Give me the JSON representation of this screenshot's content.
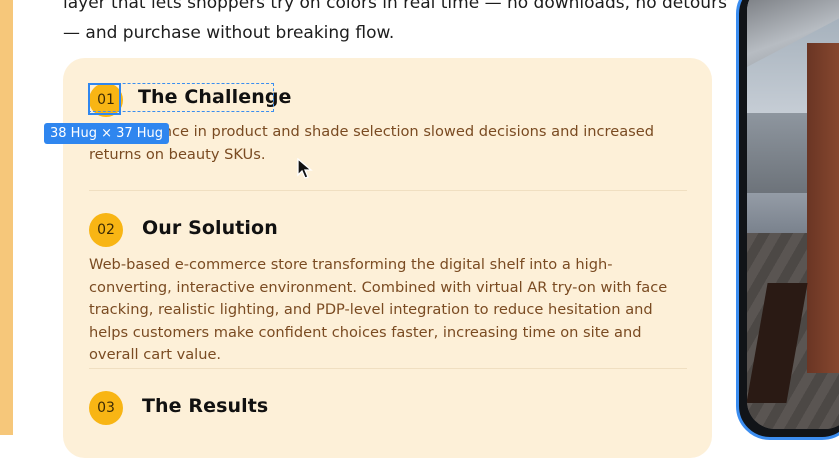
{
  "intro": {
    "line1": "layer that lets shoppers try on colors in real time — no downloads, no detours",
    "line2": "— and purchase without breaking flow."
  },
  "sections": [
    {
      "number": "01",
      "title": "The Challenge",
      "body": "Inconsistence in product and shade selection slowed decisions and increased returns on beauty SKUs."
    },
    {
      "number": "02",
      "title": "Our Solution",
      "body": "Web-based e-commerce store transforming the digital shelf into a high-converting, interactive environment. Combined with virtual AR try-on with face tracking, realistic lighting, and PDP-level integration to reduce hesitation and helps customers make confident choices faster, increasing time on site and overall cart value."
    },
    {
      "number": "03",
      "title": "The Results"
    }
  ],
  "editor": {
    "selection_size_label": "38 Hug × 37 Hug"
  },
  "colors": {
    "accent_badge": "#f8b514",
    "card_background": "#fdf0d8",
    "selection_blue": "#2f86ef",
    "body_text": "#7a4b22"
  }
}
